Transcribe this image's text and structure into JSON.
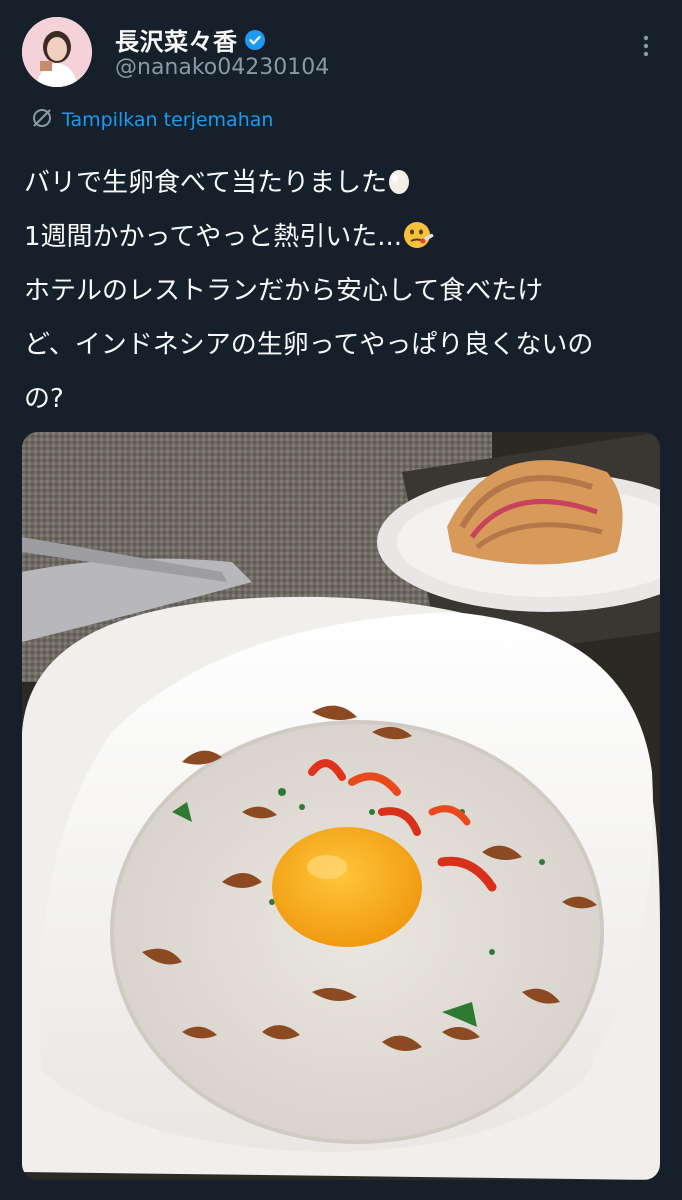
{
  "author": {
    "display_name": "長沢菜々香",
    "handle": "@nanako04230104",
    "verified": true
  },
  "translate": {
    "label": "Tampilkan terjemahan"
  },
  "tweet": {
    "lines": [
      "バリで生卵食べて当たりました",
      "1週間かかってやっと熱引いた...",
      "ホテルのレストランだから安心して食べたけ",
      "ど、インドネシアの生卵ってやっぱり良くないの",
      "の?"
    ],
    "emoji": [
      "egg",
      "face-with-thermometer"
    ]
  },
  "colors": {
    "background": "#15202b",
    "text": "#f7f9f9",
    "secondary": "#8b98a5",
    "accent": "#1d9bf0"
  },
  "icons": [
    "verified-badge-icon",
    "more-options-icon",
    "translate-icon"
  ]
}
